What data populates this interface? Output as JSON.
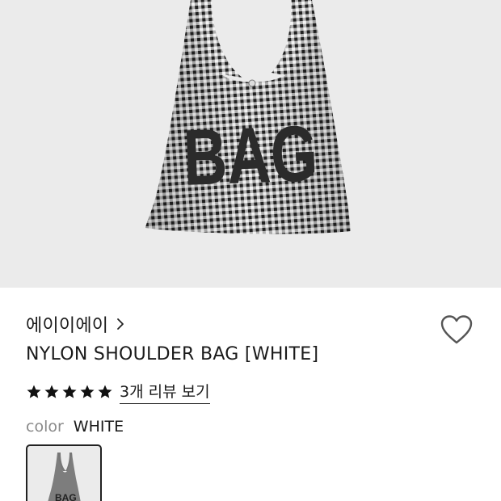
{
  "product_image": {
    "print_text": "BAG",
    "background_color": "#ebebeb"
  },
  "brand": {
    "name": "에이이에이",
    "chevron_icon": "chevron-right-icon"
  },
  "wishlist": {
    "icon": "heart-outline-icon"
  },
  "product": {
    "title": "NYLON SHOULDER BAG [WHITE]"
  },
  "rating": {
    "stars": 5,
    "max_stars": 5,
    "review_link_label": "3개 리뷰 보기"
  },
  "option": {
    "label": "color",
    "value": "WHITE"
  },
  "swatches": [
    {
      "name": "WHITE",
      "selected": true,
      "print_text": "BAG"
    }
  ]
}
